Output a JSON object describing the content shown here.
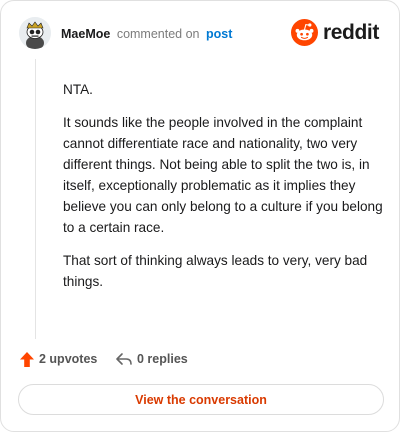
{
  "header": {
    "username": "MaeMoe",
    "action_text": "commented on",
    "post_link": "post",
    "brand": "reddit"
  },
  "comment": {
    "paragraphs": [
      "NTA.",
      "It sounds like the people involved in the complaint cannot differentiate race and nationality, two very different things. Not being able to split the two is, in itself, exceptionally problematic as it implies they believe you can only belong to a culture if you belong to a certain race.",
      "That sort of thinking always leads to very, very bad things."
    ]
  },
  "footer": {
    "upvotes_label": "2 upvotes",
    "replies_label": "0 replies",
    "cta_label": "View the conversation"
  },
  "colors": {
    "brand_orange": "#ff4500",
    "upvote_orange": "#ff4500",
    "link_blue": "#0079d3",
    "cta_text": "#d93a00"
  },
  "icons": {
    "avatar": "snoo-avatar",
    "brand": "reddit-logo-icon",
    "upvote": "upvote-arrow-icon",
    "reply": "reply-arrow-icon"
  }
}
